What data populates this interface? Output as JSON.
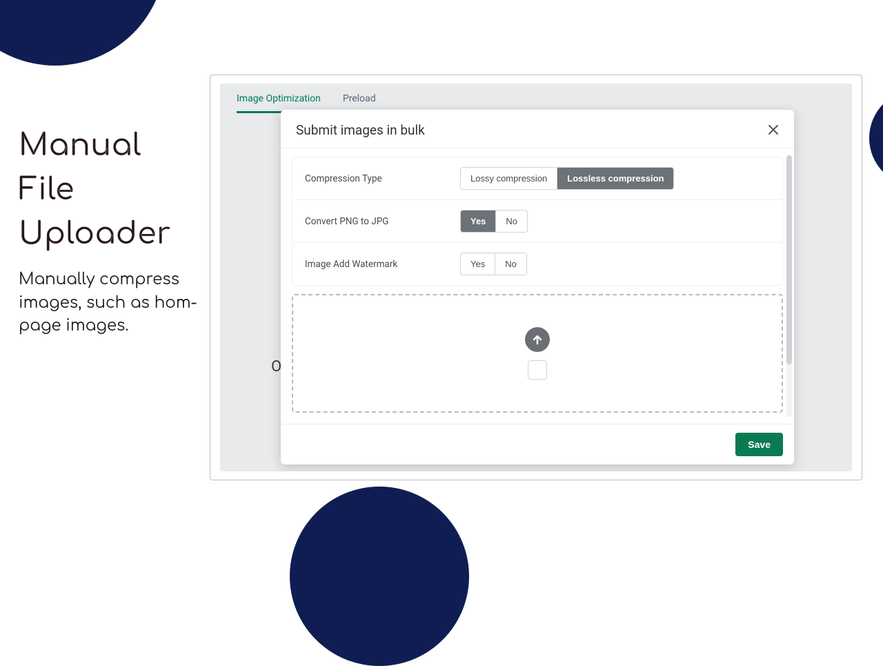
{
  "side": {
    "title_line1": "Manual File",
    "title_line2": "Uploader",
    "subtitle": "Manually compress images, such as hom-page images."
  },
  "tabs": {
    "optimization": "Image Optimization",
    "preload": "Preload"
  },
  "bg_letter": "O",
  "modal": {
    "title": "Submit images in bulk",
    "fields": {
      "compression_label": "Compression Type",
      "compression_lossy": "Lossy compression",
      "compression_lossless": "Lossless compression",
      "convert_label": "Convert PNG to JPG",
      "watermark_label": "Image Add Watermark",
      "yes": "Yes",
      "no": "No"
    },
    "save": "Save"
  },
  "colors": {
    "navy": "#0f1d52",
    "primary": "#0a7a52",
    "segment_selected": "#6c7378"
  }
}
